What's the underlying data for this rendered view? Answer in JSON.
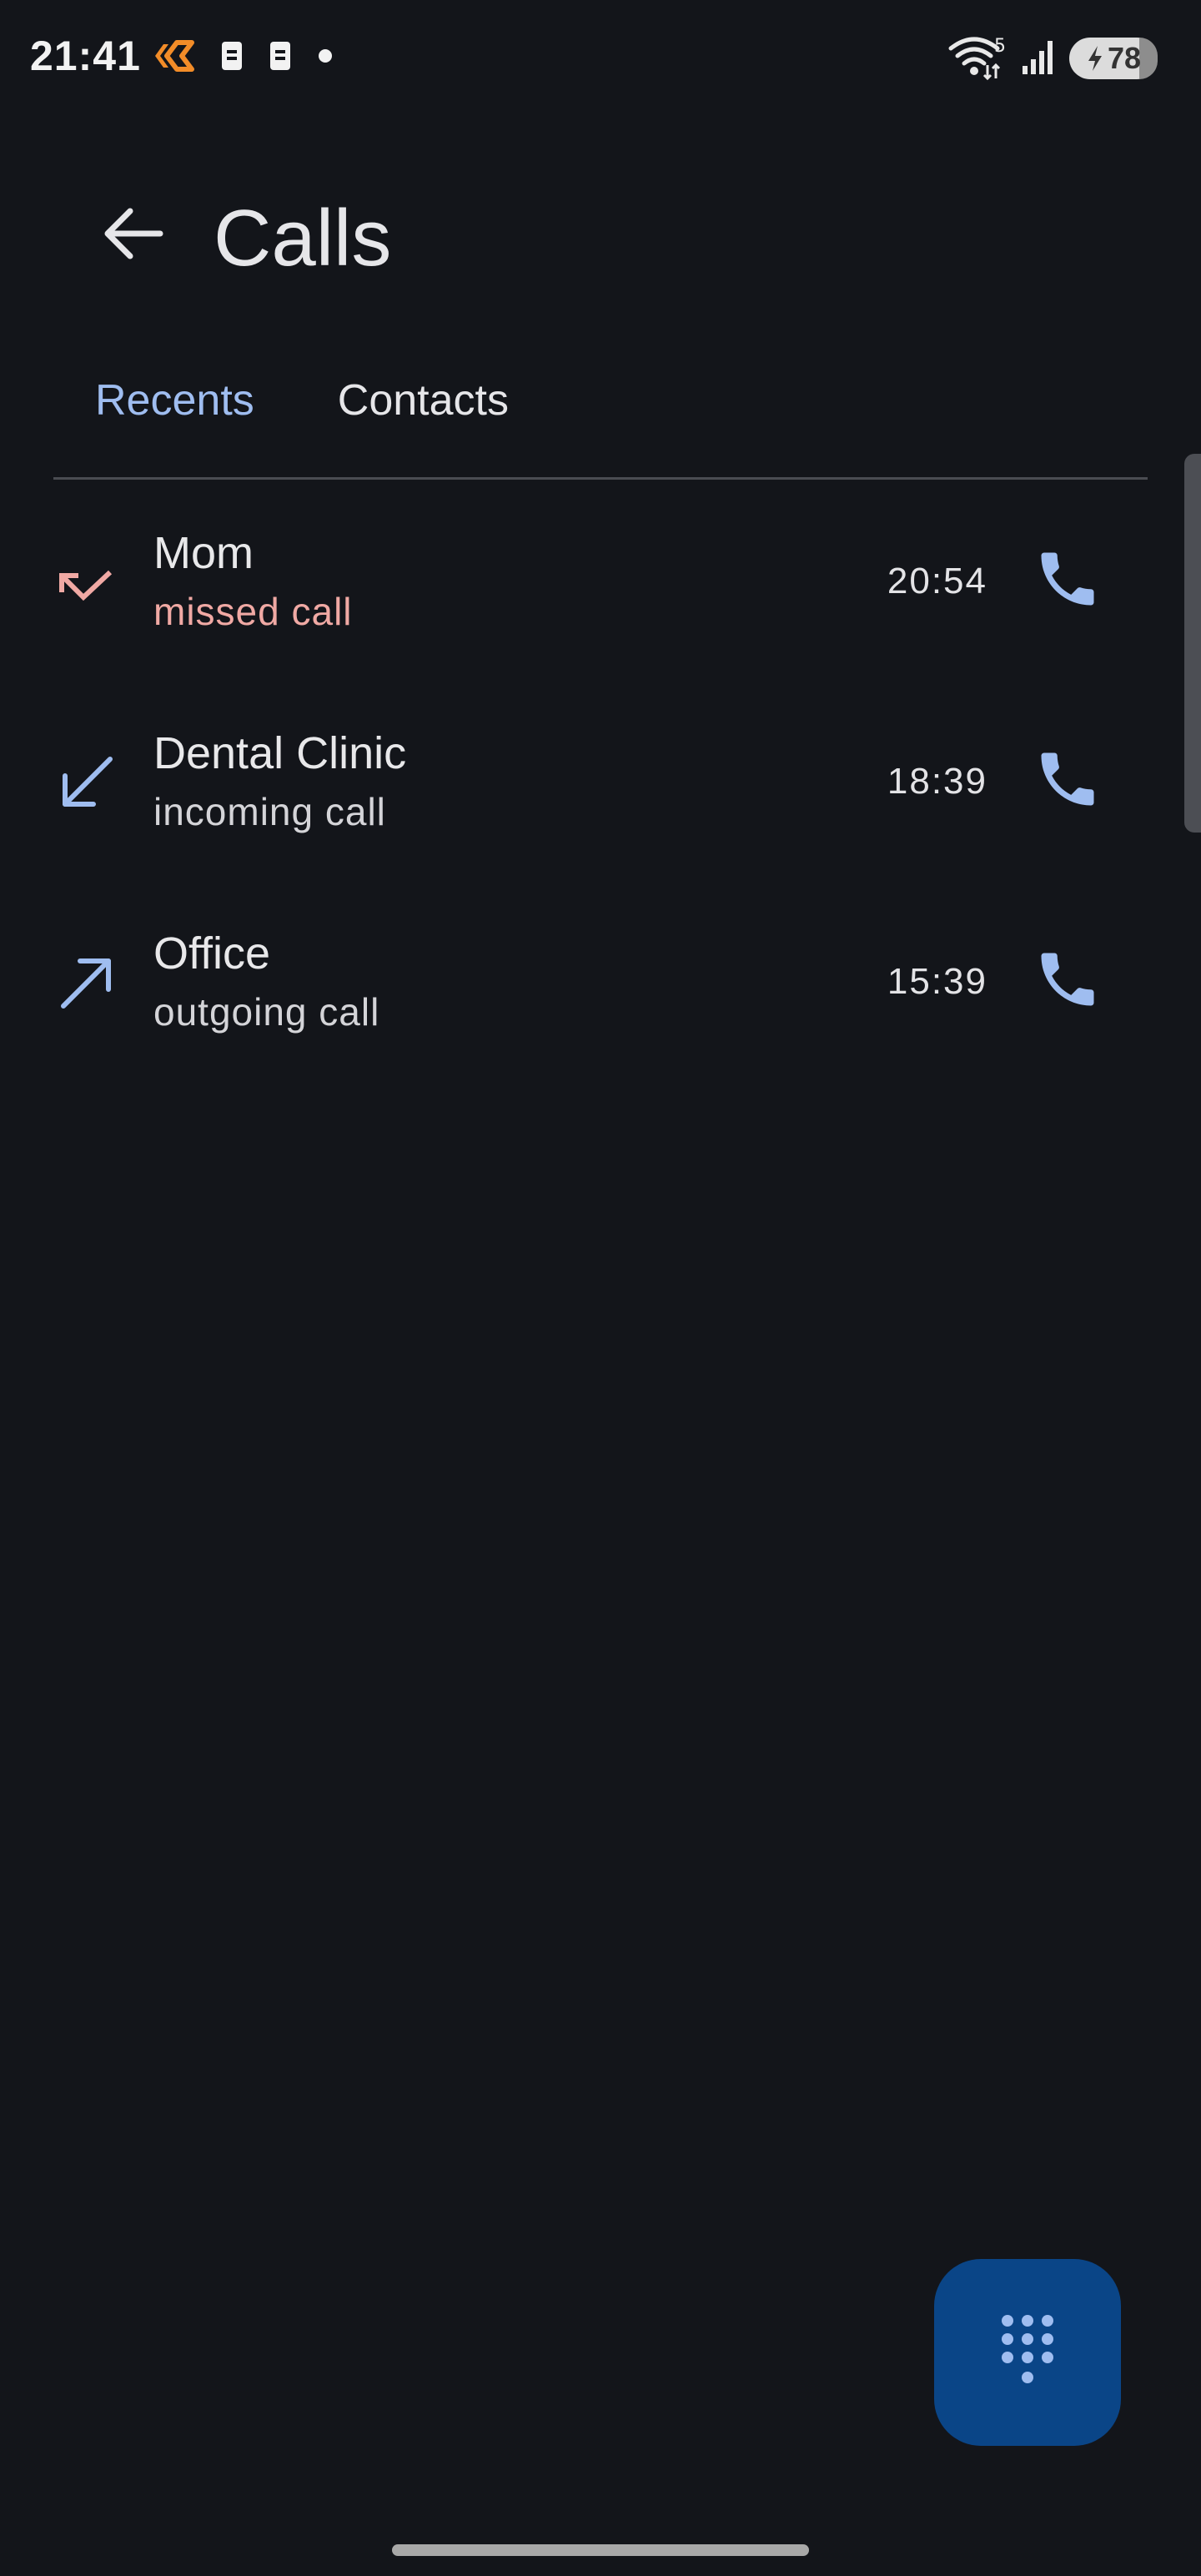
{
  "status_bar": {
    "time": "21:41",
    "battery_level": "78",
    "wifi_badge": "5",
    "icons": [
      "activity-icon",
      "sim-icon",
      "sim-icon",
      "dot-icon",
      "wifi-icon",
      "signal-icon",
      "battery-icon"
    ]
  },
  "app_bar": {
    "title": "Calls"
  },
  "tabs": [
    {
      "label": "Recents",
      "active": true
    },
    {
      "label": "Contacts",
      "active": false
    }
  ],
  "calls": [
    {
      "name": "Mom",
      "status": "missed call",
      "time": "20:54",
      "type": "missed"
    },
    {
      "name": "Dental Clinic",
      "status": "incoming call",
      "time": "18:39",
      "type": "incoming"
    },
    {
      "name": "Office",
      "status": "outgoing call",
      "time": "15:39",
      "type": "outgoing"
    }
  ],
  "colors": {
    "background": "#13151a",
    "accent": "#9fbdf0",
    "missed": "#f0a9a4",
    "fab": "#0a4587"
  }
}
